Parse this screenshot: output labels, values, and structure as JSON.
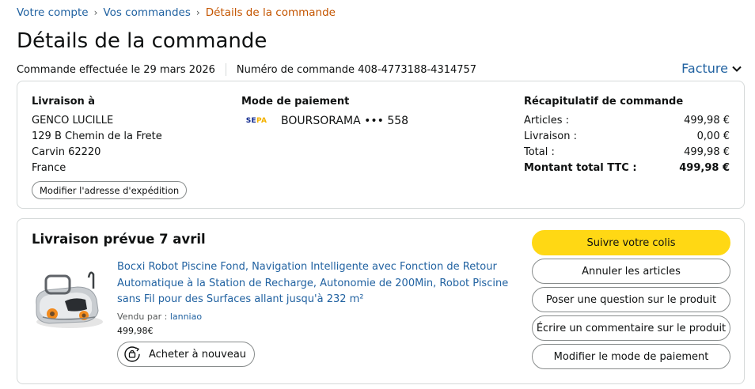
{
  "breadcrumb": {
    "items": [
      "Votre compte",
      "Vos commandes"
    ],
    "separator": "›",
    "current": "Détails de la commande"
  },
  "page_title": "Détails de la commande",
  "order_meta": {
    "placed": "Commande effectuée le 29 mars 2026",
    "number": "Numéro de commande 408-4773188-4314757"
  },
  "invoice": {
    "label": "Facture",
    "icon": "chevron-down-icon"
  },
  "shipping": {
    "heading": "Livraison à",
    "name": "GENCO LUCILLE",
    "street": "129 B Chemin de la Frete",
    "city": "Carvin 62220",
    "country": "France",
    "change_button": "Modifier l'adresse d'expédition"
  },
  "payment": {
    "heading": "Mode de paiement",
    "logo_text_1": "SE",
    "logo_text_2": "PA",
    "method": "BOURSORAMA ••• 558"
  },
  "summary": {
    "heading": "Récapitulatif de commande",
    "rows": [
      {
        "label": "Articles :",
        "value": "499,98 €"
      },
      {
        "label": "Livraison :",
        "value": "0,00 €"
      },
      {
        "label": "Total :",
        "value": "499,98 €"
      }
    ],
    "grand_total": {
      "label": "Montant total TTC :",
      "value": "499,98 €"
    }
  },
  "delivery": {
    "title": "Livraison prévue 7 avril",
    "product": {
      "title": "Bocxi Robot Piscine Fond, Navigation Intelligente avec Fonction de Retour Automatique à la Station de Recharge, Autonomie de 200Min, Robot Piscine sans Fil pour des Surfaces allant jusqu'à 232 m²",
      "sold_by_label": "Vendu par :",
      "seller": "lanniao",
      "price": "499,98€"
    },
    "buy_again": "Acheter à nouveau",
    "actions": {
      "track": "Suivre votre colis",
      "cancel": "Annuler les articles",
      "ask": "Poser une question sur le produit",
      "review": "Écrire un commentaire sur le produit",
      "change_payment": "Modifier le mode de paiement"
    }
  },
  "colors": {
    "link": "#2162a1",
    "current_crumb": "#c45500",
    "primary_button": "#ffd814",
    "border": "#d5d9d9"
  }
}
